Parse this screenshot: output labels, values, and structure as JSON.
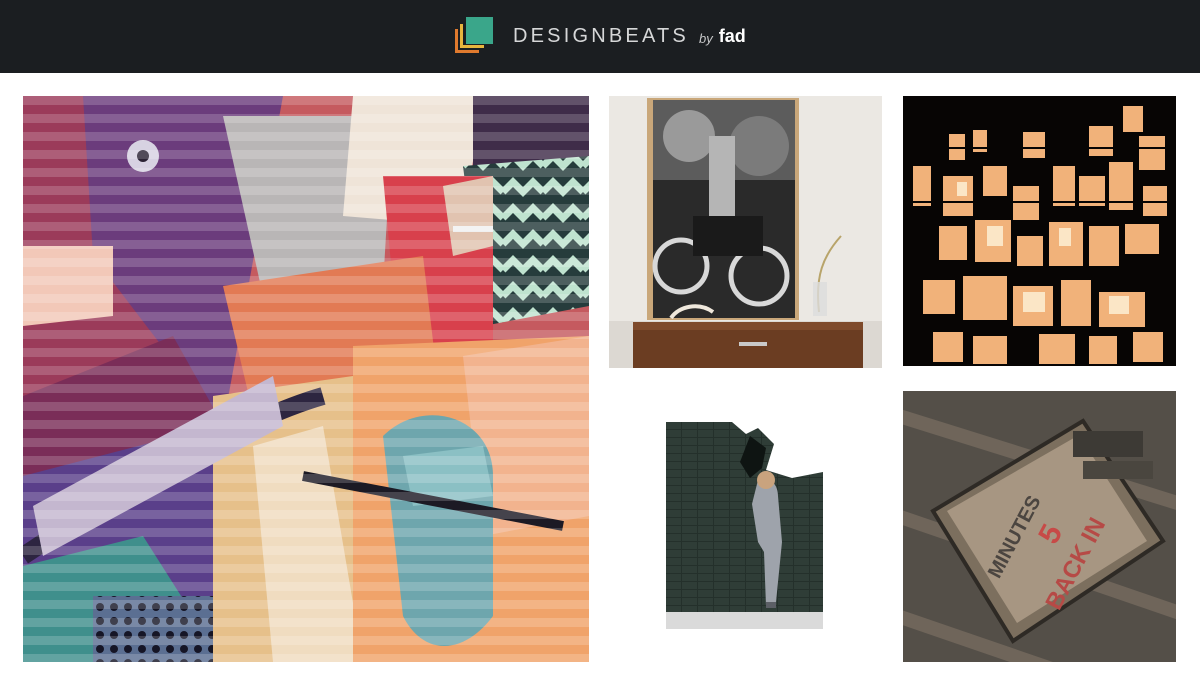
{
  "header": {
    "brand_name": "DESIGNBEATS",
    "brand_by": "by",
    "brand_fad": "fad",
    "background": "#1b1e21",
    "logo_colors": [
      "#e07a2e",
      "#e7b53d",
      "#3aa68a"
    ]
  },
  "gallery": {
    "images": [
      {
        "name": "mural-artwork",
        "subject": "colourful pop-art mural"
      },
      {
        "name": "motorcycle-print-cabinet",
        "subject": "black and white motorcycle print above wooden cabinet"
      },
      {
        "name": "lit-windows-collage",
        "subject": "collage of lit windows at night"
      },
      {
        "name": "brick-wall-girl",
        "subject": "girl peering into dark brick wall"
      },
      {
        "name": "letterpress-type",
        "subject": "wooden letterpress type blocks"
      }
    ],
    "letterpress_text": [
      "BACK IN",
      "5",
      "MINUTES"
    ]
  }
}
